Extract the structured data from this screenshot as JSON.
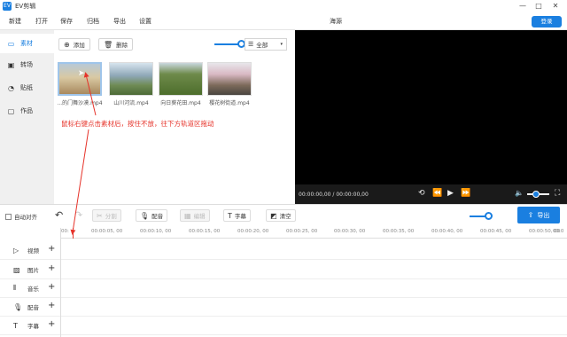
{
  "app": {
    "title": "EV剪辑",
    "logo_text": "EV",
    "project_name": "海源",
    "login_label": "登录"
  },
  "menu": [
    "新建",
    "打开",
    "保存",
    "归档",
    "导出",
    "设置"
  ],
  "nav": [
    "素材",
    "转场",
    "贴纸",
    "作品"
  ],
  "materials": {
    "add_label": "添加",
    "delete_label": "删除",
    "filter_value": "全部",
    "clips": [
      "...的门舞沙漠.mp4",
      "山川河流.mp4",
      "向日葵花田.mp4",
      "樱花树街道.mp4"
    ]
  },
  "instruction": "鼠标右键点击素材后，按住不放，往下方轨道区拖动",
  "preview": {
    "timecode": "00:00:00,00 / 00:00:00,00"
  },
  "timeline_toolbar": {
    "auto_align": "自动对齐",
    "split": "分割",
    "dub": "配音",
    "edit": "编辑",
    "subtitle": "字幕",
    "clear": "清空",
    "export": "导出"
  },
  "ruler_ticks": [
    "00:",
    "00:00:05, 00",
    "00:00:10, 00",
    "00:00:15, 00",
    "00:00:20, 00",
    "00:00:25, 00",
    "00:00:30, 00",
    "00:00:35, 00",
    "00:00:40, 00",
    "00:00:45, 00",
    "00:00:50, 00",
    "00:0"
  ],
  "tracks": [
    "视频",
    "图片",
    "音乐",
    "配音",
    "字幕"
  ],
  "colors": {
    "accent": "#1a7fe0",
    "annotation": "#e6332a"
  }
}
